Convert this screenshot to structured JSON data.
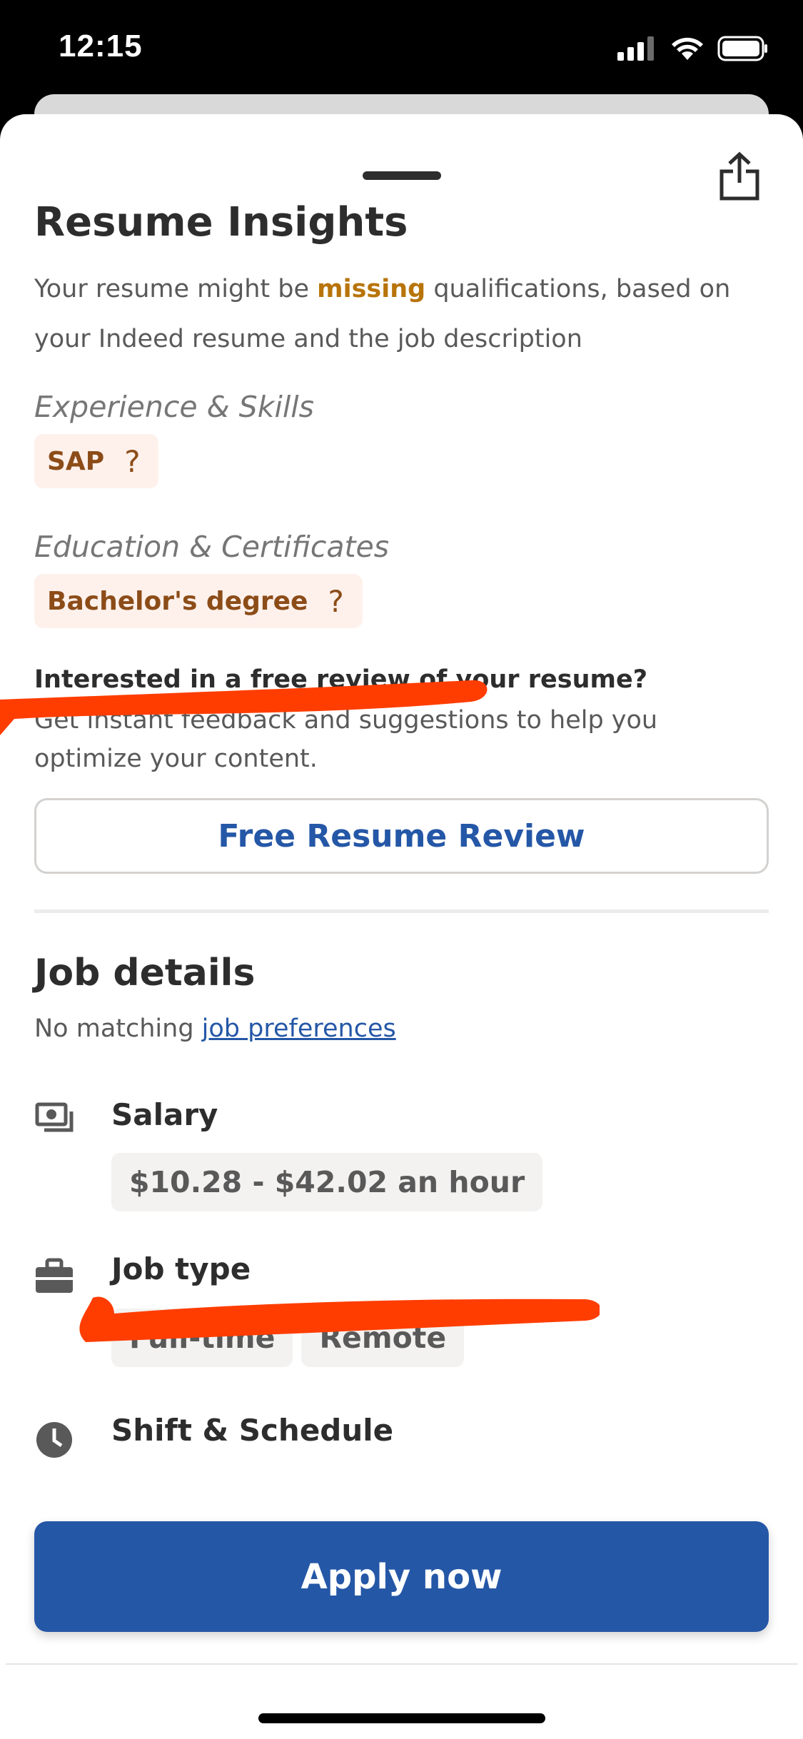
{
  "status_bar": {
    "time": "12:15"
  },
  "icons": {
    "share": "share-icon",
    "salary": "money-icon",
    "job_type": "briefcase-icon",
    "shift": "clock-icon",
    "signal": "signal-icon",
    "wifi": "wifi-icon",
    "battery": "battery-icon"
  },
  "colors": {
    "accent_blue": "#2557a7",
    "highlight_orange": "#b8740a",
    "chip_orange_bg": "#fef1ec",
    "chip_orange_text": "#8c4c18",
    "redaction": "#ff3d00"
  },
  "resume_insights": {
    "title": "Resume Insights",
    "intro_before": "Your resume might be ",
    "intro_highlight": "missing",
    "intro_after": " qualifications, based on your Indeed resume and the job description",
    "experience_label": "Experience & Skills",
    "experience_chips": [
      {
        "label": "SAP",
        "help": "?"
      }
    ],
    "education_label": "Education & Certificates",
    "education_chips": [
      {
        "label": "Bachelor's degree",
        "help": "?"
      }
    ]
  },
  "review": {
    "title": "Interested in a free review of your resume?",
    "description": "Get instant feedback and suggestions to help you optimize your content.",
    "button_label": "Free Resume Review"
  },
  "job_details": {
    "title": "Job details",
    "prefs_prefix": "No matching ",
    "prefs_link": "job preferences",
    "salary": {
      "label": "Salary",
      "value": "$10.28 - $42.02 an hour"
    },
    "job_type": {
      "label": "Job type",
      "values": [
        "Full-time",
        "Remote"
      ]
    },
    "shift": {
      "label": "Shift & Schedule"
    }
  },
  "apply": {
    "label": "Apply now"
  }
}
